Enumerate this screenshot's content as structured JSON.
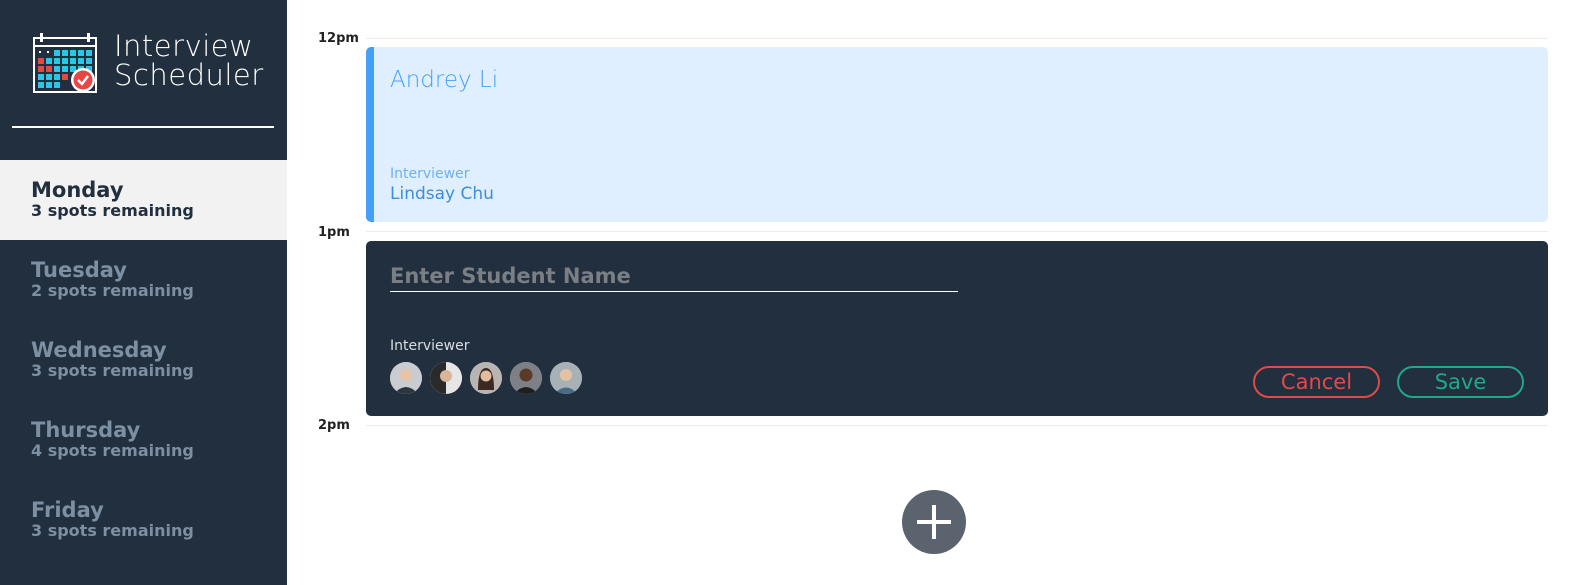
{
  "app": {
    "title_line1": "Interview",
    "title_line2": "Scheduler"
  },
  "sidebar": {
    "days": [
      {
        "name": "Monday",
        "spots": "3 spots remaining",
        "selected": true
      },
      {
        "name": "Tuesday",
        "spots": "2 spots remaining",
        "selected": false
      },
      {
        "name": "Wednesday",
        "spots": "3 spots remaining",
        "selected": false
      },
      {
        "name": "Thursday",
        "spots": "4 spots remaining",
        "selected": false
      },
      {
        "name": "Friday",
        "spots": "3 spots remaining",
        "selected": false
      }
    ]
  },
  "schedule": {
    "times": [
      "12pm",
      "1pm",
      "2pm"
    ],
    "booked": {
      "student": "Andrey Li",
      "interviewer_label": "Interviewer",
      "interviewer_name": "Lindsay Chu"
    },
    "form": {
      "student_value": "",
      "student_placeholder": "Enter Student Name",
      "interviewer_label": "Interviewer",
      "avatars": [
        "interviewer-avatar",
        "interviewer-avatar",
        "interviewer-avatar",
        "interviewer-avatar",
        "interviewer-avatar"
      ],
      "cancel_label": "Cancel",
      "save_label": "Save"
    },
    "add_icon": "plus-icon"
  },
  "colors": {
    "sidebar_bg": "#222f3e",
    "selected_day_bg": "#f2f2f2",
    "booked_bg": "#e0efff",
    "booked_accent": "#44a0f7",
    "cancel": "#e04a4a",
    "save": "#1fa88a",
    "add_button": "#5a636e"
  }
}
